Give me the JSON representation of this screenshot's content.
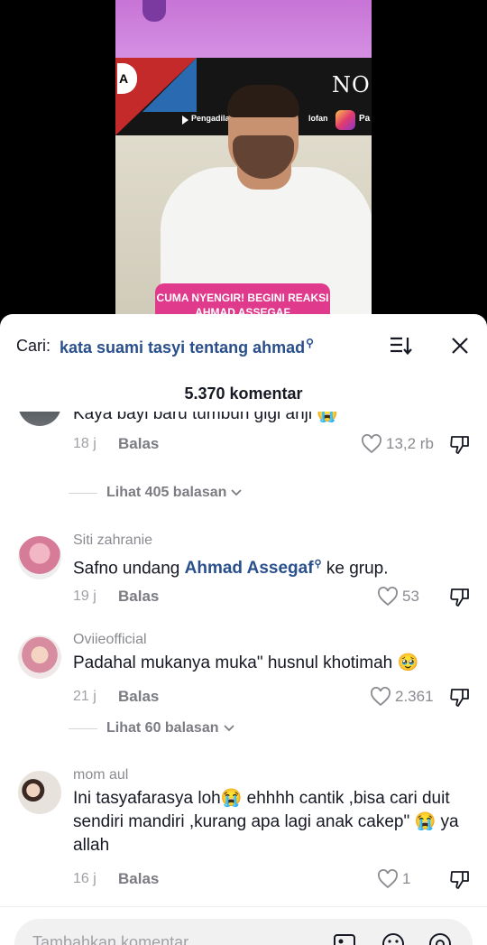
{
  "video": {
    "banner_text": "NO",
    "caption": "CUMA NYENGIR! BEGINI REAKSI AHMAD ASSEGAF",
    "tag_left": "Pengadila",
    "tag_right": "Pa",
    "tag_mid": "lofan"
  },
  "search": {
    "label": "Cari:",
    "term": "kata suami tasyi tentang ahmad"
  },
  "comments_count": "5.370 komentar",
  "comments": [
    {
      "username": "",
      "text": "Kaya bayi baru tumbuh gigi anji 😭",
      "time": "18 j",
      "reply_label": "Balas",
      "likes": "13,2 rb",
      "view_replies": "Lihat 405 balasan"
    },
    {
      "username": "Siti zahranie",
      "text_before": "Safno undang",
      "mention": "Ahmad Assegaf",
      "text_after": "ke grup.",
      "time": "19 j",
      "reply_label": "Balas",
      "likes": "53"
    },
    {
      "username": "Oviieofficial",
      "text": "Padahal mukanya muka\" husnul khotimah 🥹",
      "time": "21 j",
      "reply_label": "Balas",
      "likes": "2.361",
      "view_replies": "Lihat 60 balasan"
    },
    {
      "username": "mom aul",
      "text": "Ini tasyafarasya loh😭 ehhhh cantik ,bisa cari duit sendiri mandiri ,kurang apa lagi anak cakep\" 😭 ya allah",
      "time": "16 j",
      "reply_label": "Balas",
      "likes": "1"
    }
  ],
  "input": {
    "placeholder": "Tambahkan komentar..."
  },
  "icons": {
    "search": "search-icon",
    "sort": "sort-icon",
    "close": "close-icon",
    "like": "heart-icon",
    "dislike": "dislike-icon",
    "image": "image-icon",
    "emoji": "emoji-icon",
    "mention": "at-icon"
  },
  "colors": {
    "mention": "#2a4f8d",
    "text": "#161823",
    "muted": "#8a8b91",
    "caption_bg": "#e03a8c"
  }
}
